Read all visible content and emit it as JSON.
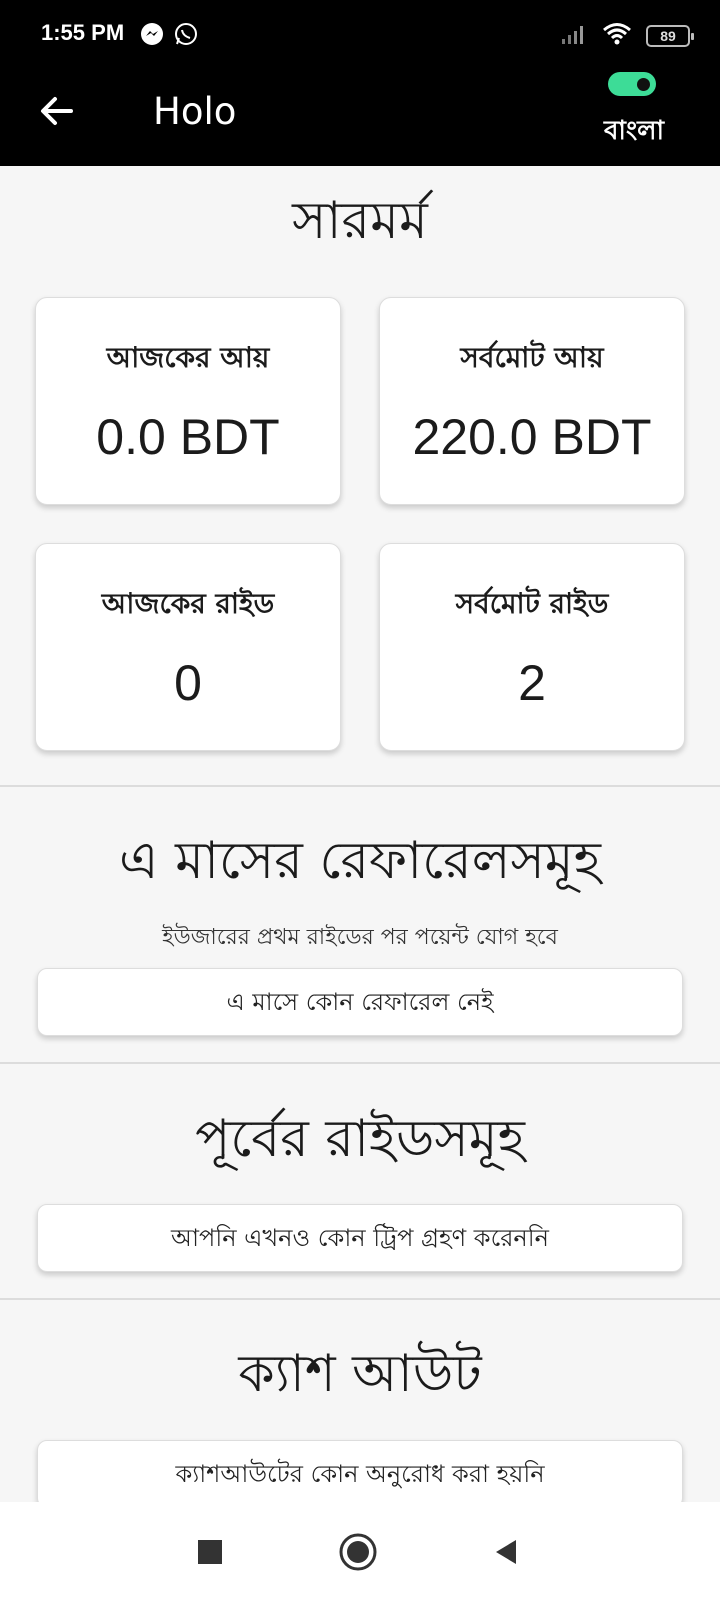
{
  "status_bar": {
    "time": "1:55 PM",
    "battery": "89",
    "left_icons": [
      "messenger-icon",
      "whatsapp-icon"
    ],
    "right_icons": [
      "signal-icon",
      "wifi-icon",
      "battery-icon"
    ]
  },
  "app_bar": {
    "title": "Holo",
    "language_toggle_on": true,
    "language_label": "বাংলা",
    "toggle_color": "#3ddc97"
  },
  "summary": {
    "title": "সারমর্ম",
    "cards": [
      {
        "label": "আজকের আয়",
        "value": "0.0 BDT"
      },
      {
        "label": "সর্বমোট আয়",
        "value": "220.0 BDT"
      },
      {
        "label": "আজকের রাইড",
        "value": "0"
      },
      {
        "label": "সর্বমোট রাইড",
        "value": "2"
      }
    ]
  },
  "referrals": {
    "title": "এ মাসের রেফারেলসমূহ",
    "note": "ইউজারের প্রথম রাইডের পর পয়েন্ট যোগ হবে",
    "empty_message": "এ মাসে কোন রেফারেল নেই"
  },
  "previous_rides": {
    "title": "পূর্বের রাইডসমূহ",
    "empty_message": "আপনি এখনও কোন ট্রিপ গ্রহণ করেননি"
  },
  "cashout": {
    "title": "ক্যাশ আউট",
    "empty_message": "ক্যাশআউটের কোন অনুরোধ করা হয়নি"
  }
}
